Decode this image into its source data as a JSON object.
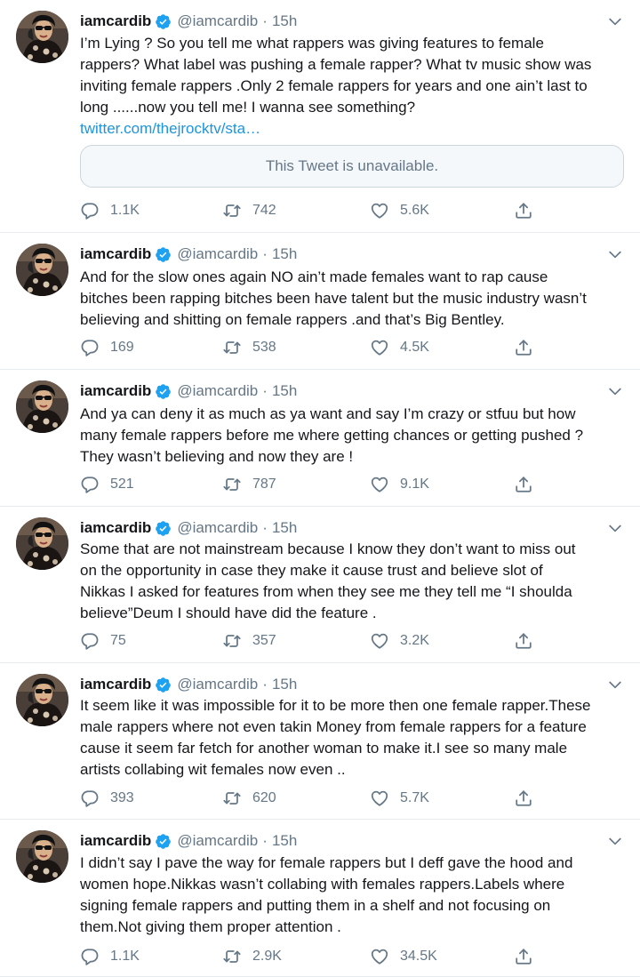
{
  "tweets": [
    {
      "name": "iamcardib",
      "handle": "@iamcardib",
      "time": "15h",
      "lines": [
        "I’m Lying ? So you tell me what rappers was giving features to female",
        "rappers? What label was pushing a female rapper? What tv music show was",
        "inviting female rappers .Only 2 female rappers for years and one ain’t last to",
        "long ......now you tell me! I wanna see something?"
      ],
      "link": "twitter.com/thejrocktv/sta…",
      "quote": "This Tweet is unavailable.",
      "replies": "1.1K",
      "retweets": "742",
      "likes": "5.6K"
    },
    {
      "name": "iamcardib",
      "handle": "@iamcardib",
      "time": "15h",
      "lines": [
        "And for the slow ones again NO ain’t made females want to rap cause",
        "bitches been rapping bitches been have talent but the music industry wasn’t",
        "believing and shitting on female rappers .and that’s Big Bentley."
      ],
      "replies": "169",
      "retweets": "538",
      "likes": "4.5K"
    },
    {
      "name": "iamcardib",
      "handle": "@iamcardib",
      "time": "15h",
      "lines": [
        "And ya can deny it as much as ya want and say I’m crazy or stfuu but how",
        "many female rappers before me where getting chances or getting pushed ?",
        "They wasn’t believing and now they are !"
      ],
      "replies": "521",
      "retweets": "787",
      "likes": "9.1K"
    },
    {
      "name": "iamcardib",
      "handle": "@iamcardib",
      "time": "15h",
      "lines": [
        "Some that are not mainstream because I know they don’t want to miss out",
        "on the opportunity in case they make it cause trust and believe slot of",
        "Nikkas I asked for features from when they see me they tell me “I shoulda",
        "believe”Deum I should have did the feature ."
      ],
      "replies": "75",
      "retweets": "357",
      "likes": "3.2K"
    },
    {
      "name": "iamcardib",
      "handle": "@iamcardib",
      "time": "15h",
      "lines": [
        "It seem like it was impossible for it to be more then one female rapper.These",
        "male rappers where not even takin Money from female rappers for a feature",
        "cause it seem far fetch for another woman to make it.I see so many male",
        "artists collabing wit females now even .."
      ],
      "replies": "393",
      "retweets": "620",
      "likes": "5.7K"
    },
    {
      "name": "iamcardib",
      "handle": "@iamcardib",
      "time": "15h",
      "lines": [
        "I didn’t say I pave the way for female rappers but I deff gave the hood and",
        "women hope.Nikkas wasn’t collabing with females rappers.Labels where",
        "signing female rappers and putting them in a shelf and not focusing on",
        "them.Not giving them proper attention ."
      ],
      "replies": "1.1K",
      "retweets": "2.9K",
      "likes": "34.5K"
    }
  ],
  "colors": {
    "verified": "#1da1f2",
    "link": "#1b95e0",
    "muted": "#657786",
    "divider": "#e6ecf0"
  },
  "icons": {
    "verified": "verified-badge-icon",
    "caret": "chevron-down-icon",
    "reply": "reply-icon",
    "retweet": "retweet-icon",
    "like": "heart-icon",
    "share": "share-icon"
  }
}
